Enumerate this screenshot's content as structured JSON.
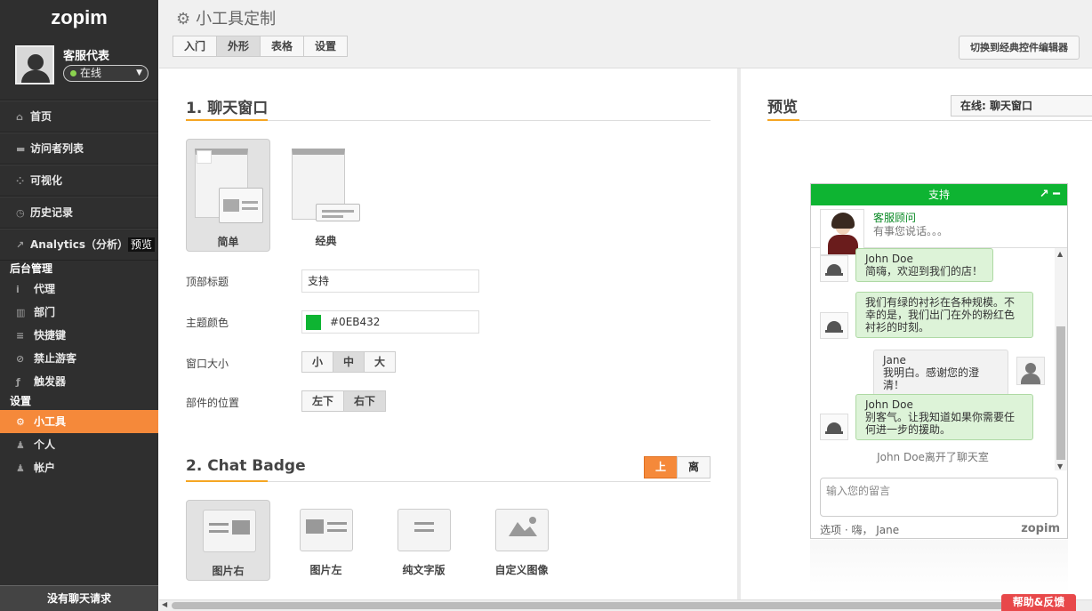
{
  "sidebar": {
    "logo": "zopim",
    "profile": {
      "name": "客服代表",
      "status": "在线"
    },
    "nav": [
      {
        "icon": "⌂",
        "label": "首页"
      },
      {
        "icon": "▬",
        "label": "访问者列表"
      },
      {
        "icon": "⁘",
        "label": "可视化"
      },
      {
        "icon": "◷",
        "label": "历史记录"
      },
      {
        "icon": "↗",
        "label": "Analytics（分析）",
        "tag": "预览"
      }
    ],
    "admin_header": "后台管理",
    "admin": [
      {
        "icon": "𝗶",
        "label": "代理"
      },
      {
        "icon": "▥",
        "label": "部门"
      },
      {
        "icon": "≡",
        "label": "快捷键"
      },
      {
        "icon": "⊘",
        "label": "禁止游客"
      },
      {
        "icon": "ƒ",
        "label": "触发器"
      }
    ],
    "settings_header": "设置",
    "settings": [
      {
        "icon": "⚙",
        "label": "小工具"
      },
      {
        "icon": "♟",
        "label": "个人"
      },
      {
        "icon": "♟",
        "label": "帐户"
      }
    ],
    "no_chat": "没有聊天请求"
  },
  "header": {
    "title": "小工具定制",
    "tabs": [
      "入门",
      "外形",
      "表格",
      "设置"
    ],
    "classic_btn": "切换到经典控件编辑器"
  },
  "section1": {
    "title": "1. 聊天窗口",
    "layouts": [
      "简单",
      "经典"
    ],
    "fields": {
      "top_title_label": "顶部标题",
      "top_title_value": "支持",
      "theme_color_label": "主题颜色",
      "theme_color_value": "#0EB432",
      "size_label": "窗口大小",
      "sizes": [
        "小",
        "中",
        "大"
      ],
      "pos_label": "部件的位置",
      "positions": [
        "左下",
        "右下"
      ]
    }
  },
  "section2": {
    "title": "2. Chat Badge",
    "toggle": [
      "上",
      "离"
    ],
    "options": [
      "图片右",
      "图片左",
      "纯文字版",
      "自定义图像"
    ]
  },
  "preview": {
    "title": "预览",
    "select": "在线: 聊天窗口",
    "chat": {
      "header": "支持",
      "controls": "↗ ━",
      "agent_name": "客服顾问",
      "agent_tagline": "有事您说话。。。",
      "messages": [
        {
          "name": "John Doe",
          "text": "简嗨，欢迎到我们的店！"
        },
        {
          "text": "我们有绿的衬衫在各种规模。不幸的是，我们出门在外的粉红色衬衫的时刻。"
        },
        {
          "name": "Jane",
          "text": "我明白。感谢您的澄清！"
        },
        {
          "name": "John Doe",
          "text": "别客气。让我知道如果你需要任何进一步的援助。"
        }
      ],
      "left_note": "John Doe离开了聊天室",
      "input_placeholder": "输入您的留言",
      "footer": "选项 · 嗨，  Jane",
      "brand": "zopim"
    }
  },
  "help_btn": "帮助&反馈",
  "colors": {
    "accent": "#f5893a",
    "theme": "#0EB432",
    "sidebar": "#2f2f2f"
  }
}
